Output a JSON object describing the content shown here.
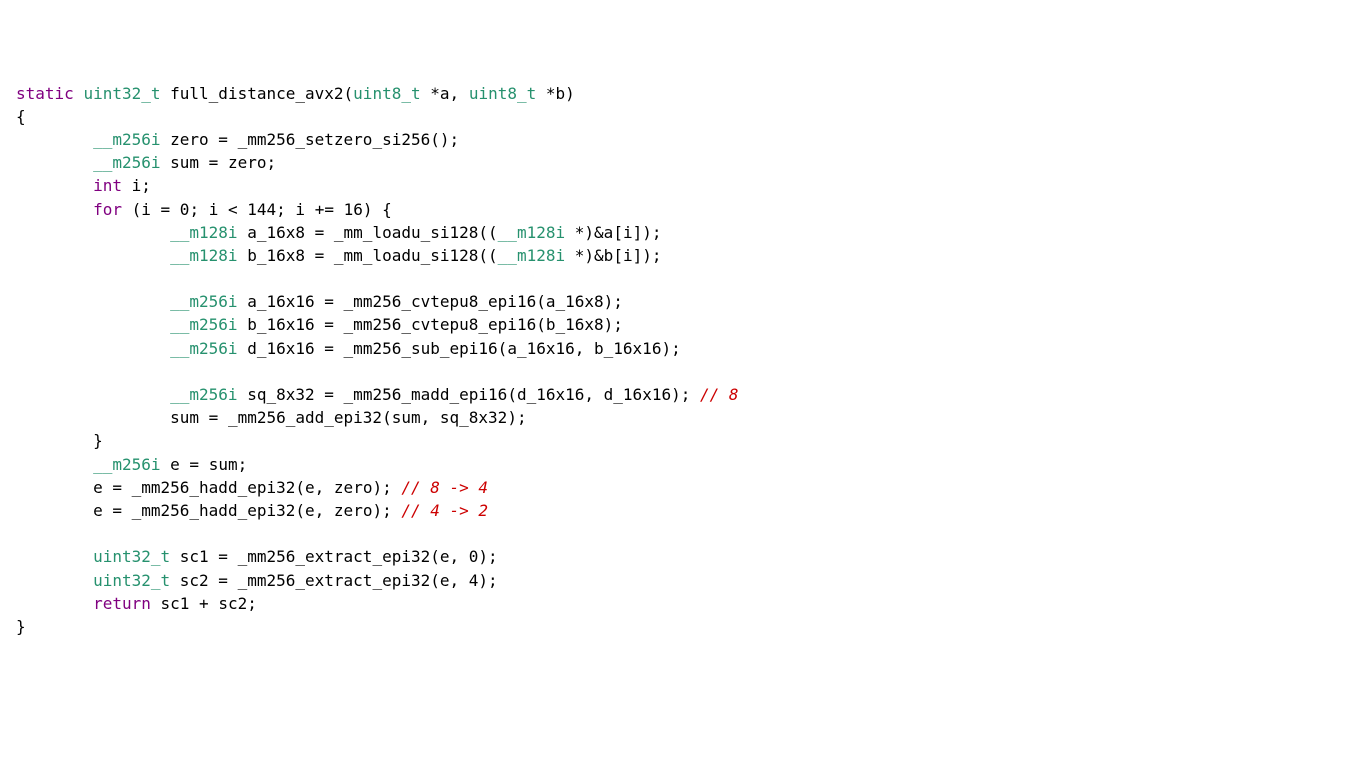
{
  "code": {
    "l1": {
      "static": "static",
      "u32": "uint32_t",
      "fn": "full_distance_avx2",
      "lp": "(",
      "u8a": "uint8_t",
      "star1": "*",
      "a": "a",
      "c1": ",",
      "sp1": " ",
      "u8b": "uint8_t",
      "star2": "*",
      "b": "b",
      "rp": ")"
    },
    "l2": {
      "brace": "{"
    },
    "l3": {
      "ind": "        ",
      "t": "__m256i",
      "sp": " ",
      "zero": "zero",
      "eq": " = ",
      "fn": "_mm256_setzero_si256",
      "call": "();"
    },
    "l4": {
      "ind": "        ",
      "t": "__m256i",
      "sp": " ",
      "sum": "sum",
      "eq": " = ",
      "zero": "zero",
      "semi": ";"
    },
    "l5": {
      "ind": "        ",
      "t": "int",
      "sp": " ",
      "i": "i",
      "semi": ";"
    },
    "l6": {
      "ind": "        ",
      "for": "for",
      "sp": " ",
      "lp": "(",
      "i": "i",
      "eq1": " = ",
      "z": "0",
      "semi1": "; ",
      "i2": "i",
      "lt": " < ",
      "n": "144",
      "semi2": "; ",
      "i3": "i",
      "pe": " += ",
      "inc": "16",
      "rp": ")",
      "sp2": " ",
      "brace": "{"
    },
    "l7": {
      "ind": "                ",
      "t": "__m128i",
      "sp": " ",
      "v": "a_16x8",
      "eq": " = ",
      "fn": "_mm_loadu_si128",
      "lp": "((",
      "cast": "__m128i",
      "sp2": " ",
      "star": "*",
      "rp1": ")",
      "amp": "&",
      "arr": "a",
      "lb": "[",
      "idx": "i",
      "rb": "]",
      "end": ");"
    },
    "l8": {
      "ind": "                ",
      "t": "__m128i",
      "sp": " ",
      "v": "b_16x8",
      "eq": " = ",
      "fn": "_mm_loadu_si128",
      "lp": "((",
      "cast": "__m128i",
      "sp2": " ",
      "star": "*",
      "rp1": ")",
      "amp": "&",
      "arr": "b",
      "lb": "[",
      "idx": "i",
      "rb": "]",
      "end": ");"
    },
    "l9": {
      "blank": ""
    },
    "l10": {
      "ind": "                ",
      "t": "__m256i",
      "sp": " ",
      "v": "a_16x16",
      "eq": " = ",
      "fn": "_mm256_cvtepu8_epi16",
      "lp": "(",
      "arg": "a_16x8",
      "rp": ");"
    },
    "l11": {
      "ind": "                ",
      "t": "__m256i",
      "sp": " ",
      "v": "b_16x16",
      "eq": " = ",
      "fn": "_mm256_cvtepu8_epi16",
      "lp": "(",
      "arg": "b_16x8",
      "rp": ");"
    },
    "l12": {
      "ind": "                ",
      "t": "__m256i",
      "sp": " ",
      "v": "d_16x16",
      "eq": " = ",
      "fn": "_mm256_sub_epi16",
      "lp": "(",
      "a1": "a_16x16",
      "c": ", ",
      "a2": "b_16x16",
      "rp": ");"
    },
    "l13": {
      "blank": ""
    },
    "l14": {
      "ind": "                ",
      "t": "__m256i",
      "sp": " ",
      "v": "sq_8x32",
      "eq": " = ",
      "fn": "_mm256_madd_epi16",
      "lp": "(",
      "a1": "d_16x16",
      "c": ", ",
      "a2": "d_16x16",
      "rp": ");",
      "sp2": " ",
      "cmt": "// 8"
    },
    "l15": {
      "ind": "                ",
      "sum": "sum",
      "eq": " = ",
      "fn": "_mm256_add_epi32",
      "lp": "(",
      "a1": "sum",
      "c": ", ",
      "a2": "sq_8x32",
      "rp": ");"
    },
    "l16": {
      "ind": "        ",
      "brace": "}"
    },
    "l17": {
      "ind": "        ",
      "t": "__m256i",
      "sp": " ",
      "e": "e",
      "eq": " = ",
      "sum": "sum",
      "semi": ";"
    },
    "l18": {
      "ind": "        ",
      "e": "e",
      "eq": " = ",
      "fn": "_mm256_hadd_epi32",
      "lp": "(",
      "a1": "e",
      "c": ", ",
      "a2": "zero",
      "rp": ");",
      "sp": " ",
      "cmt": "// 8 -> 4"
    },
    "l19": {
      "ind": "        ",
      "e": "e",
      "eq": " = ",
      "fn": "_mm256_hadd_epi32",
      "lp": "(",
      "a1": "e",
      "c": ", ",
      "a2": "zero",
      "rp": ");",
      "sp": " ",
      "cmt": "// 4 -> 2"
    },
    "l20": {
      "blank": ""
    },
    "l21": {
      "ind": "        ",
      "t": "uint32_t",
      "sp": " ",
      "v": "sc1",
      "eq": " = ",
      "fn": "_mm256_extract_epi32",
      "lp": "(",
      "a1": "e",
      "c": ", ",
      "a2": "0",
      "rp": ");"
    },
    "l22": {
      "ind": "        ",
      "t": "uint32_t",
      "sp": " ",
      "v": "sc2",
      "eq": " = ",
      "fn": "_mm256_extract_epi32",
      "lp": "(",
      "a1": "e",
      "c": ", ",
      "a2": "4",
      "rp": ");"
    },
    "l23": {
      "ind": "        ",
      "ret": "return",
      "sp": " ",
      "a1": "sc1",
      "plus": " + ",
      "a2": "sc2",
      "semi": ";"
    },
    "l24": {
      "brace": "}"
    }
  }
}
